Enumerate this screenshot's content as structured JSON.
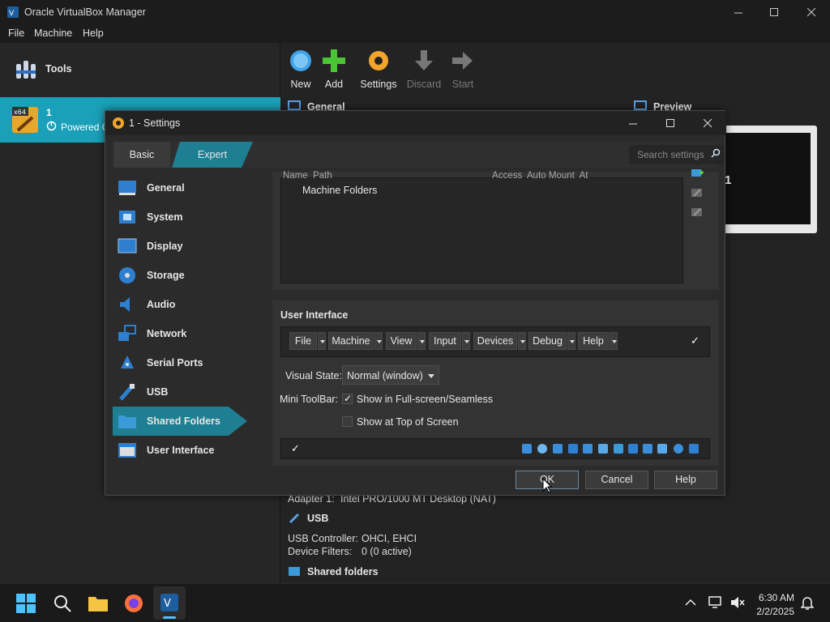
{
  "window": {
    "title": "Oracle VirtualBox Manager"
  },
  "menubar": {
    "file": "File",
    "machine": "Machine",
    "help": "Help"
  },
  "sidebar": {
    "tools_label": "Tools",
    "vm": {
      "name": "1",
      "state": "Powered O",
      "arch_badge": "x64"
    }
  },
  "toolbar": {
    "new": "New",
    "add": "Add",
    "settings": "Settings",
    "discard": "Discard",
    "start": "Start"
  },
  "details": {
    "general": "General",
    "preview": "Preview",
    "preview_label": "1",
    "adapter_label": "Adapter 1:",
    "adapter_value": "Intel PRO/1000 MT Desktop (NAT)",
    "usb_heading": "USB",
    "usb_controller_label": "USB Controller:",
    "usb_controller_value": "OHCI, EHCI",
    "device_filters_label": "Device Filters:",
    "device_filters_value": "0 (0 active)",
    "shared_folders_heading": "Shared folders"
  },
  "dialog": {
    "title": "1 - Settings",
    "modes": {
      "basic": "Basic",
      "expert": "Expert",
      "selected": "Expert"
    },
    "search_placeholder": "Search settings",
    "nav": [
      {
        "label": "General",
        "icon": "monitor-icon"
      },
      {
        "label": "System",
        "icon": "chip-icon"
      },
      {
        "label": "Display",
        "icon": "display-icon"
      },
      {
        "label": "Storage",
        "icon": "disk-icon"
      },
      {
        "label": "Audio",
        "icon": "speaker-icon"
      },
      {
        "label": "Network",
        "icon": "network-icon"
      },
      {
        "label": "Serial Ports",
        "icon": "serial-port-icon"
      },
      {
        "label": "USB",
        "icon": "usb-icon"
      },
      {
        "label": "Shared Folders",
        "icon": "folder-icon"
      },
      {
        "label": "User Interface",
        "icon": "window-icon"
      }
    ],
    "selected_nav": "Shared Folders",
    "folders": {
      "header_cut": "Name  Path                                                              Access  Auto Mount  At",
      "item": "Machine Folders"
    },
    "user_interface": {
      "caption": "User Interface",
      "menus": [
        "File",
        "Machine",
        "View",
        "Input",
        "Devices",
        "Debug",
        "Help"
      ],
      "visual_state_label": "Visual State:",
      "visual_state_value": "Normal (window)",
      "mini_toolbar_label": "Mini ToolBar:",
      "show_fullscreen": "Show in Full-screen/Seamless",
      "show_fullscreen_checked": true,
      "show_top": "Show at Top of Screen",
      "show_top_checked": false
    },
    "buttons": {
      "ok": "OK",
      "cancel": "Cancel",
      "help": "Help"
    }
  },
  "taskbar": {
    "time": "6:30 AM",
    "date": "2/2/2025"
  },
  "colors": {
    "accent": "#1e7f92",
    "selection": "#1aa0b8"
  }
}
